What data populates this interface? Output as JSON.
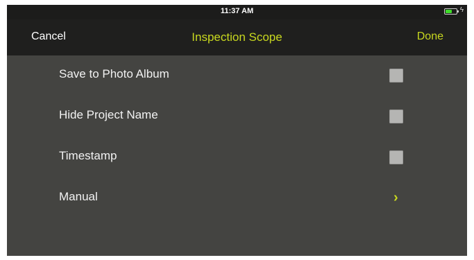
{
  "status_bar": {
    "time": "11:37 AM",
    "battery_level": 0.6,
    "battery_color": "#3fdd2b"
  },
  "nav": {
    "cancel_label": "Cancel",
    "title": "Inspection Scope",
    "done_label": "Done"
  },
  "settings": {
    "items": [
      {
        "label": "Save to Photo Album",
        "control": "checkbox",
        "checked": false
      },
      {
        "label": "Hide Project Name",
        "control": "checkbox",
        "checked": false
      },
      {
        "label": "Timestamp",
        "control": "checkbox",
        "checked": false
      },
      {
        "label": "Manual",
        "control": "disclosure",
        "icon": "chevron-right-icon",
        "glyph": "›"
      }
    ]
  },
  "colors": {
    "accent": "#c8d81f",
    "background": "#444441",
    "nav_background": "#1f1f1e"
  }
}
